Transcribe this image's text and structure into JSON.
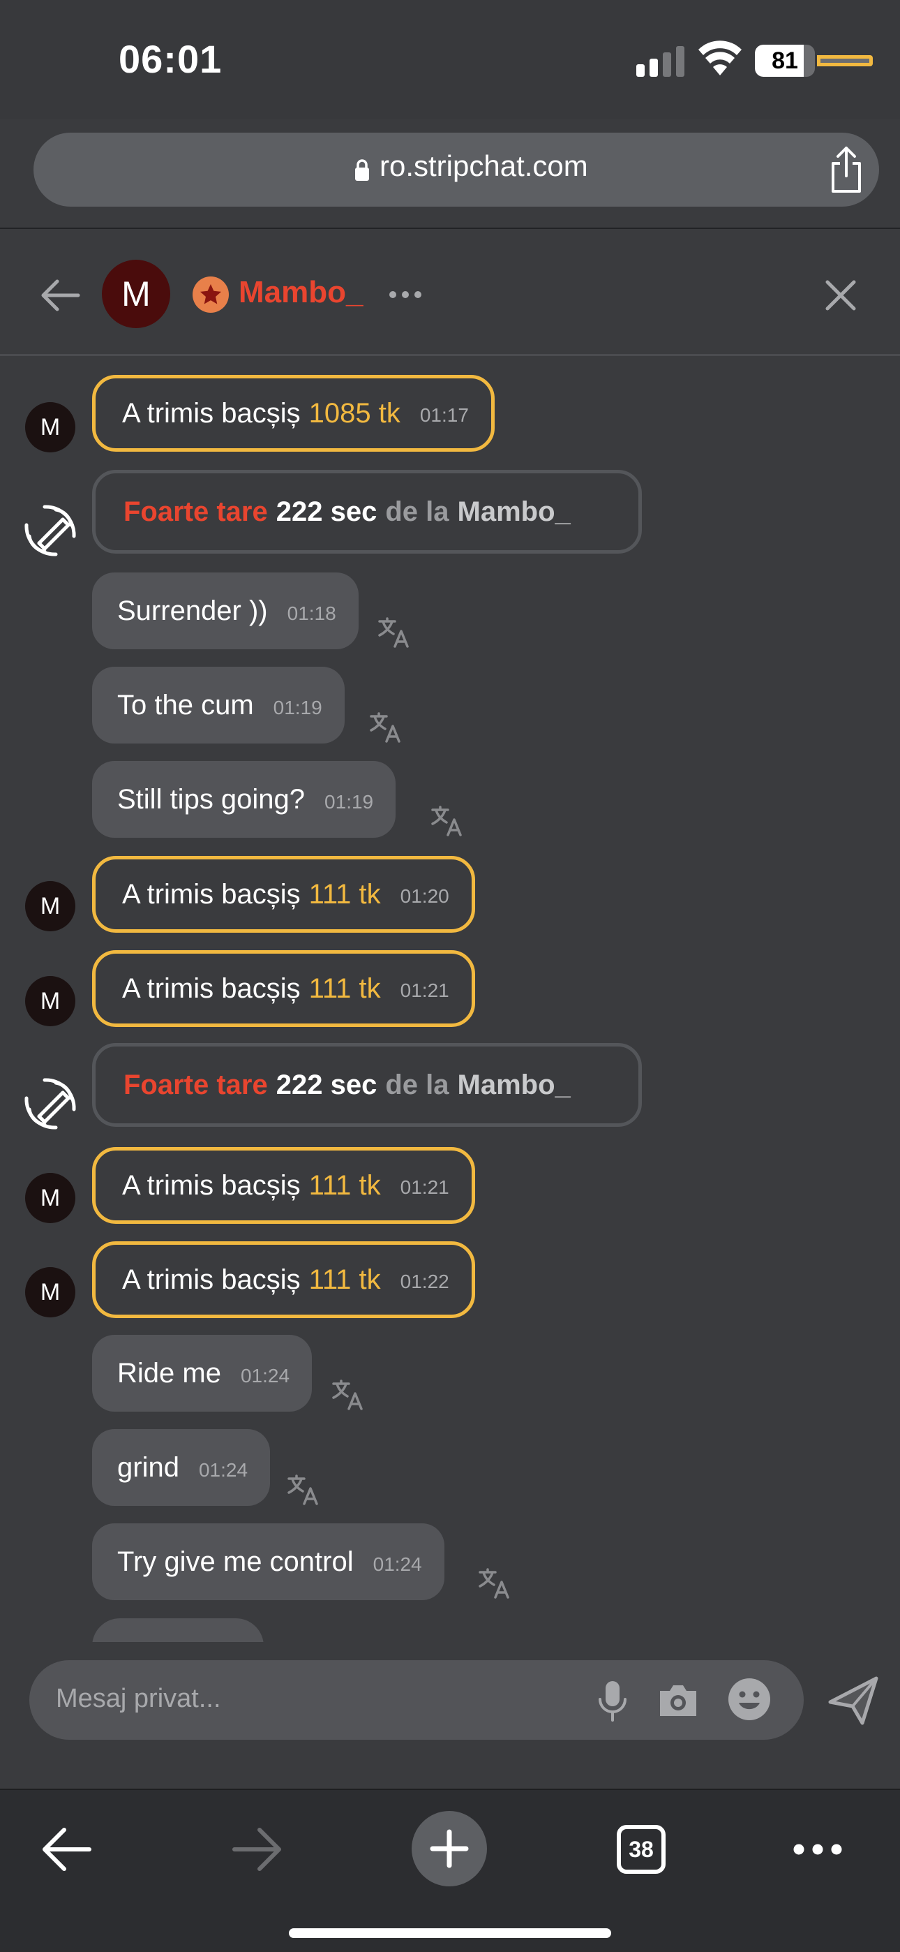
{
  "status_bar": {
    "time": "06:01",
    "battery": "81",
    "battery_level": 0.81
  },
  "browser": {
    "url": "ro.stripchat.com",
    "tabs_count": "38"
  },
  "chat_header": {
    "avatar_letter": "M",
    "username": "Mambo_"
  },
  "messages": [
    {
      "kind": "tip",
      "avatar": "M",
      "text": "A trimis bacșiș",
      "amount": "1085 tk",
      "time": "01:17"
    },
    {
      "kind": "vibe",
      "level": "Foarte tare",
      "duration": "222 sec",
      "from_label": "de la",
      "from": "Mambo_"
    },
    {
      "kind": "text",
      "text": "Surrender ))",
      "time": "01:18"
    },
    {
      "kind": "text",
      "text": "To the cum",
      "time": "01:19"
    },
    {
      "kind": "text",
      "text": "Still tips going?",
      "time": "01:19"
    },
    {
      "kind": "tip",
      "avatar": "M",
      "text": "A trimis bacșiș",
      "amount": "111 tk",
      "time": "01:20"
    },
    {
      "kind": "tip",
      "avatar": "M",
      "text": "A trimis bacșiș",
      "amount": "111 tk",
      "time": "01:21"
    },
    {
      "kind": "vibe",
      "level": "Foarte tare",
      "duration": "222 sec",
      "from_label": "de la",
      "from": "Mambo_"
    },
    {
      "kind": "tip",
      "avatar": "M",
      "text": "A trimis bacșiș",
      "amount": "111 tk",
      "time": "01:21"
    },
    {
      "kind": "tip",
      "avatar": "M",
      "text": "A trimis bacșiș",
      "amount": "111 tk",
      "time": "01:22"
    },
    {
      "kind": "text",
      "text": "Ride me",
      "time": "01:24"
    },
    {
      "kind": "text",
      "text": "grind",
      "time": "01:24"
    },
    {
      "kind": "text",
      "text": "Try give me control",
      "time": "01:24"
    }
  ],
  "composer": {
    "placeholder": "Mesaj privat..."
  },
  "colors": {
    "accent_red": "#e9452f",
    "tip_gold": "#f2b940",
    "background": "#3a3b3e",
    "bubble": "#535458"
  },
  "icons": [
    "back-arrow-icon",
    "star-icon",
    "more-dots-icon",
    "close-icon",
    "vibration-icon",
    "translate-icon",
    "mic-icon",
    "camera-icon",
    "emoji-icon",
    "send-icon",
    "share-icon",
    "lock-icon",
    "plus-icon",
    "wifi-icon",
    "signal-icon"
  ]
}
